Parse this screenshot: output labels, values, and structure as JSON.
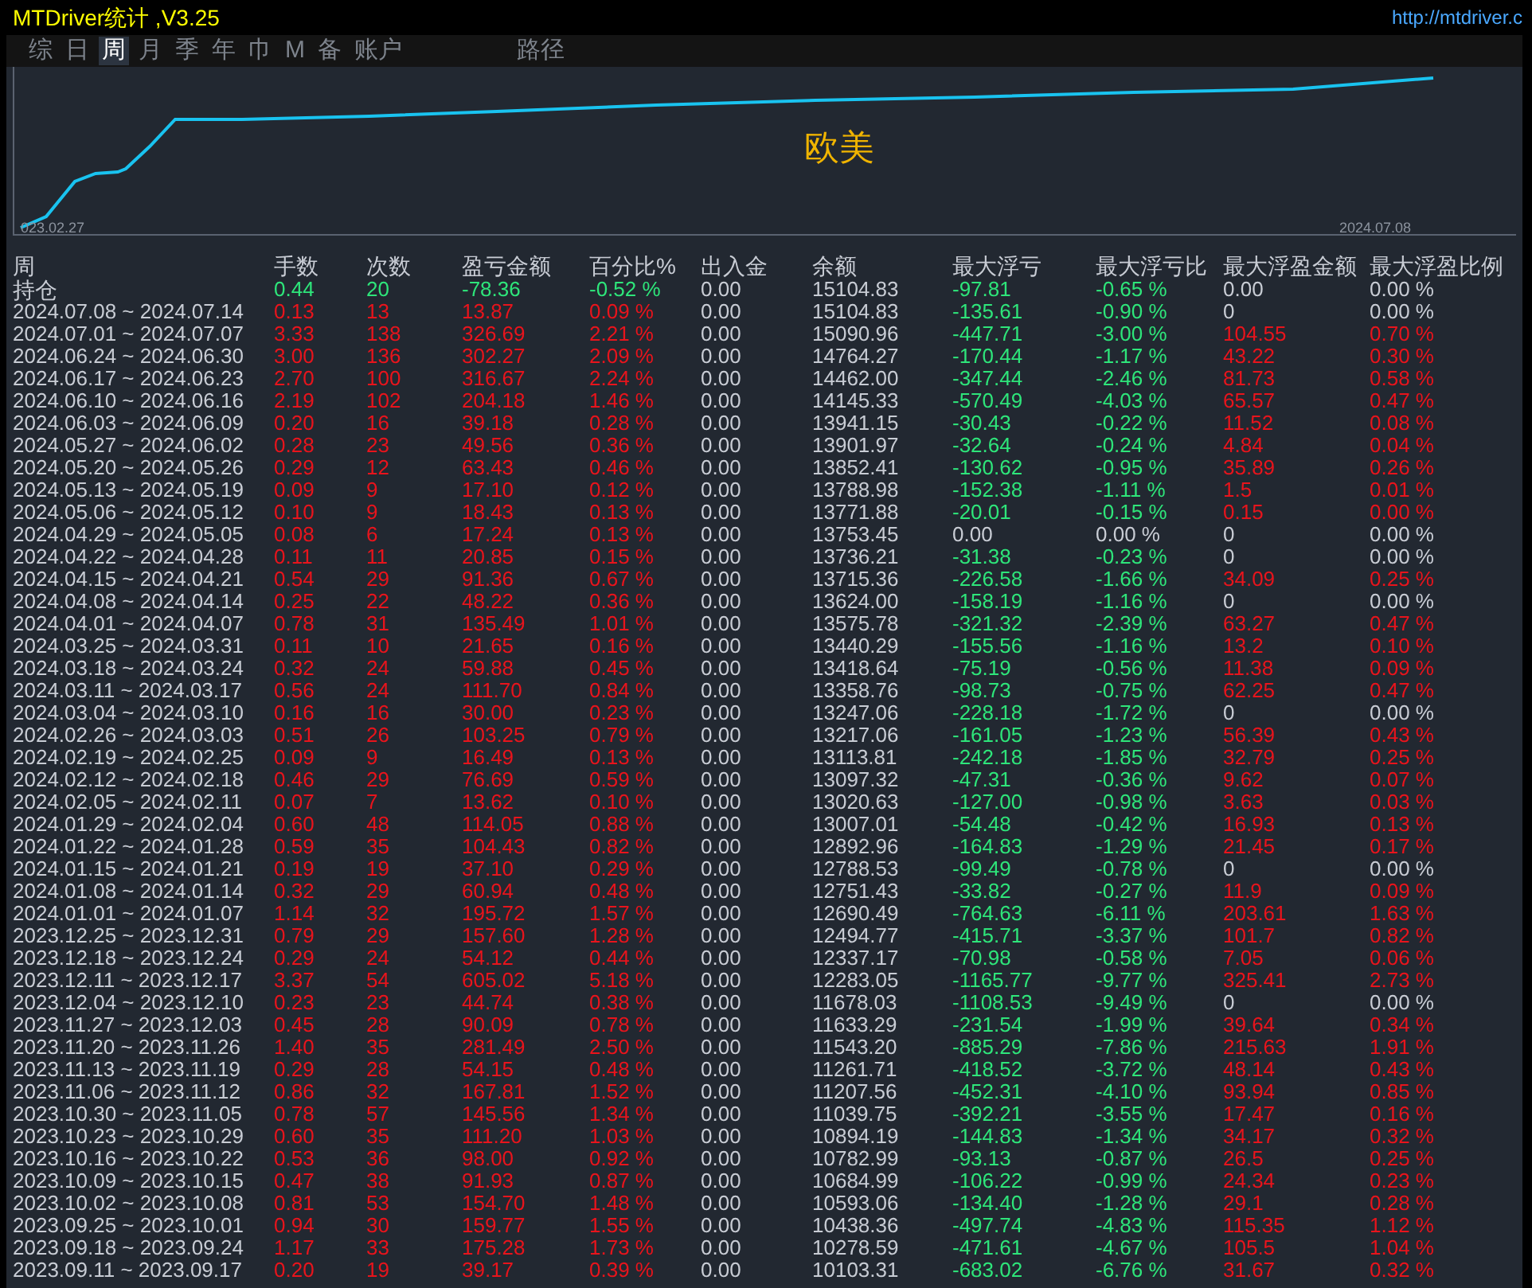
{
  "window": {
    "title": "MTDriver统计 ,V3.25",
    "link": "http://mtdriver.c"
  },
  "tabs": [
    {
      "label": "综",
      "selected": false
    },
    {
      "label": "日",
      "selected": false
    },
    {
      "label": "周",
      "selected": true
    },
    {
      "label": "月",
      "selected": false
    },
    {
      "label": "季",
      "selected": false
    },
    {
      "label": "年",
      "selected": false
    },
    {
      "label": "巾",
      "selected": false
    },
    {
      "label": "M",
      "selected": false
    },
    {
      "label": "备",
      "selected": false
    },
    {
      "label": "账户",
      "selected": false
    },
    {
      "label": "路径",
      "selected": false,
      "kind": "spaced"
    }
  ],
  "chart": {
    "symbol": "欧美",
    "start_label": "023.02.27",
    "end_label": "2024.07.08"
  },
  "table": {
    "columns": [
      "周",
      "手数",
      "次数",
      "盈亏金额",
      "百分比%",
      "出入金",
      "余额",
      "最大浮亏",
      "最大浮亏比",
      "最大浮盈金额",
      "最大浮盈比例"
    ],
    "rows": [
      {
        "cells": [
          "持仓",
          "0.44",
          "20",
          "-78.36",
          "-0.52 %",
          "0.00",
          "15104.83",
          "-97.81",
          "-0.65 %",
          "0.00",
          "0.00 %"
        ],
        "in_profit": false,
        "float_loss": true,
        "float_profit": false
      },
      {
        "cells": [
          "2024.07.08 ~ 2024.07.14",
          "0.13",
          "13",
          "13.87",
          "0.09 %",
          "0.00",
          "15104.83",
          "-135.61",
          "-0.90 %",
          "0",
          "0.00 %"
        ],
        "in_profit": true,
        "float_loss": true,
        "float_profit": false
      },
      {
        "cells": [
          "2024.07.01 ~ 2024.07.07",
          "3.33",
          "138",
          "326.69",
          "2.21 %",
          "0.00",
          "15090.96",
          "-447.71",
          "-3.00 %",
          "104.55",
          "0.70 %"
        ],
        "in_profit": true,
        "float_loss": true,
        "float_profit": true
      },
      {
        "cells": [
          "2024.06.24 ~ 2024.06.30",
          "3.00",
          "136",
          "302.27",
          "2.09 %",
          "0.00",
          "14764.27",
          "-170.44",
          "-1.17 %",
          "43.22",
          "0.30 %"
        ],
        "in_profit": true,
        "float_loss": true,
        "float_profit": true
      },
      {
        "cells": [
          "2024.06.17 ~ 2024.06.23",
          "2.70",
          "100",
          "316.67",
          "2.24 %",
          "0.00",
          "14462.00",
          "-347.44",
          "-2.46 %",
          "81.73",
          "0.58 %"
        ],
        "in_profit": true,
        "float_loss": true,
        "float_profit": true
      },
      {
        "cells": [
          "2024.06.10 ~ 2024.06.16",
          "2.19",
          "102",
          "204.18",
          "1.46 %",
          "0.00",
          "14145.33",
          "-570.49",
          "-4.03 %",
          "65.57",
          "0.47 %"
        ],
        "in_profit": true,
        "float_loss": true,
        "float_profit": true
      },
      {
        "cells": [
          "2024.06.03 ~ 2024.06.09",
          "0.20",
          "16",
          "39.18",
          "0.28 %",
          "0.00",
          "13941.15",
          "-30.43",
          "-0.22 %",
          "11.52",
          "0.08 %"
        ],
        "in_profit": true,
        "float_loss": true,
        "float_profit": true
      },
      {
        "cells": [
          "2024.05.27 ~ 2024.06.02",
          "0.28",
          "23",
          "49.56",
          "0.36 %",
          "0.00",
          "13901.97",
          "-32.64",
          "-0.24 %",
          "4.84",
          "0.04 %"
        ],
        "in_profit": true,
        "float_loss": true,
        "float_profit": true
      },
      {
        "cells": [
          "2024.05.20 ~ 2024.05.26",
          "0.29",
          "12",
          "63.43",
          "0.46 %",
          "0.00",
          "13852.41",
          "-130.62",
          "-0.95 %",
          "35.89",
          "0.26 %"
        ],
        "in_profit": true,
        "float_loss": true,
        "float_profit": true
      },
      {
        "cells": [
          "2024.05.13 ~ 2024.05.19",
          "0.09",
          "9",
          "17.10",
          "0.12 %",
          "0.00",
          "13788.98",
          "-152.38",
          "-1.11 %",
          "1.5",
          "0.01 %"
        ],
        "in_profit": true,
        "float_loss": true,
        "float_profit": true
      },
      {
        "cells": [
          "2024.05.06 ~ 2024.05.12",
          "0.10",
          "9",
          "18.43",
          "0.13 %",
          "0.00",
          "13771.88",
          "-20.01",
          "-0.15 %",
          "0.15",
          "0.00 %"
        ],
        "in_profit": true,
        "float_loss": true,
        "float_profit": true
      },
      {
        "cells": [
          "2024.04.29 ~ 2024.05.05",
          "0.08",
          "6",
          "17.24",
          "0.13 %",
          "0.00",
          "13753.45",
          "0.00",
          "0.00 %",
          "0",
          "0.00 %"
        ],
        "in_profit": true,
        "float_loss": false,
        "float_profit": false
      },
      {
        "cells": [
          "2024.04.22 ~ 2024.04.28",
          "0.11",
          "11",
          "20.85",
          "0.15 %",
          "0.00",
          "13736.21",
          "-31.38",
          "-0.23 %",
          "0",
          "0.00 %"
        ],
        "in_profit": true,
        "float_loss": true,
        "float_profit": false
      },
      {
        "cells": [
          "2024.04.15 ~ 2024.04.21",
          "0.54",
          "29",
          "91.36",
          "0.67 %",
          "0.00",
          "13715.36",
          "-226.58",
          "-1.66 %",
          "34.09",
          "0.25 %"
        ],
        "in_profit": true,
        "float_loss": true,
        "float_profit": true
      },
      {
        "cells": [
          "2024.04.08 ~ 2024.04.14",
          "0.25",
          "22",
          "48.22",
          "0.36 %",
          "0.00",
          "13624.00",
          "-158.19",
          "-1.16 %",
          "0",
          "0.00 %"
        ],
        "in_profit": true,
        "float_loss": true,
        "float_profit": false
      },
      {
        "cells": [
          "2024.04.01 ~ 2024.04.07",
          "0.78",
          "31",
          "135.49",
          "1.01 %",
          "0.00",
          "13575.78",
          "-321.32",
          "-2.39 %",
          "63.27",
          "0.47 %"
        ],
        "in_profit": true,
        "float_loss": true,
        "float_profit": true
      },
      {
        "cells": [
          "2024.03.25 ~ 2024.03.31",
          "0.11",
          "10",
          "21.65",
          "0.16 %",
          "0.00",
          "13440.29",
          "-155.56",
          "-1.16 %",
          "13.2",
          "0.10 %"
        ],
        "in_profit": true,
        "float_loss": true,
        "float_profit": true
      },
      {
        "cells": [
          "2024.03.18 ~ 2024.03.24",
          "0.32",
          "24",
          "59.88",
          "0.45 %",
          "0.00",
          "13418.64",
          "-75.19",
          "-0.56 %",
          "11.38",
          "0.09 %"
        ],
        "in_profit": true,
        "float_loss": true,
        "float_profit": true
      },
      {
        "cells": [
          "2024.03.11 ~ 2024.03.17",
          "0.56",
          "24",
          "111.70",
          "0.84 %",
          "0.00",
          "13358.76",
          "-98.73",
          "-0.75 %",
          "62.25",
          "0.47 %"
        ],
        "in_profit": true,
        "float_loss": true,
        "float_profit": true
      },
      {
        "cells": [
          "2024.03.04 ~ 2024.03.10",
          "0.16",
          "16",
          "30.00",
          "0.23 %",
          "0.00",
          "13247.06",
          "-228.18",
          "-1.72 %",
          "0",
          "0.00 %"
        ],
        "in_profit": true,
        "float_loss": true,
        "float_profit": false
      },
      {
        "cells": [
          "2024.02.26 ~ 2024.03.03",
          "0.51",
          "26",
          "103.25",
          "0.79 %",
          "0.00",
          "13217.06",
          "-161.05",
          "-1.23 %",
          "56.39",
          "0.43 %"
        ],
        "in_profit": true,
        "float_loss": true,
        "float_profit": true
      },
      {
        "cells": [
          "2024.02.19 ~ 2024.02.25",
          "0.09",
          "9",
          "16.49",
          "0.13 %",
          "0.00",
          "13113.81",
          "-242.18",
          "-1.85 %",
          "32.79",
          "0.25 %"
        ],
        "in_profit": true,
        "float_loss": true,
        "float_profit": true
      },
      {
        "cells": [
          "2024.02.12 ~ 2024.02.18",
          "0.46",
          "29",
          "76.69",
          "0.59 %",
          "0.00",
          "13097.32",
          "-47.31",
          "-0.36 %",
          "9.62",
          "0.07 %"
        ],
        "in_profit": true,
        "float_loss": true,
        "float_profit": true
      },
      {
        "cells": [
          "2024.02.05 ~ 2024.02.11",
          "0.07",
          "7",
          "13.62",
          "0.10 %",
          "0.00",
          "13020.63",
          "-127.00",
          "-0.98 %",
          "3.63",
          "0.03 %"
        ],
        "in_profit": true,
        "float_loss": true,
        "float_profit": true
      },
      {
        "cells": [
          "2024.01.29 ~ 2024.02.04",
          "0.60",
          "48",
          "114.05",
          "0.88 %",
          "0.00",
          "13007.01",
          "-54.48",
          "-0.42 %",
          "16.93",
          "0.13 %"
        ],
        "in_profit": true,
        "float_loss": true,
        "float_profit": true
      },
      {
        "cells": [
          "2024.01.22 ~ 2024.01.28",
          "0.59",
          "35",
          "104.43",
          "0.82 %",
          "0.00",
          "12892.96",
          "-164.83",
          "-1.29 %",
          "21.45",
          "0.17 %"
        ],
        "in_profit": true,
        "float_loss": true,
        "float_profit": true
      },
      {
        "cells": [
          "2024.01.15 ~ 2024.01.21",
          "0.19",
          "19",
          "37.10",
          "0.29 %",
          "0.00",
          "12788.53",
          "-99.49",
          "-0.78 %",
          "0",
          "0.00 %"
        ],
        "in_profit": true,
        "float_loss": true,
        "float_profit": false
      },
      {
        "cells": [
          "2024.01.08 ~ 2024.01.14",
          "0.32",
          "29",
          "60.94",
          "0.48 %",
          "0.00",
          "12751.43",
          "-33.82",
          "-0.27 %",
          "11.9",
          "0.09 %"
        ],
        "in_profit": true,
        "float_loss": true,
        "float_profit": true
      },
      {
        "cells": [
          "2024.01.01 ~ 2024.01.07",
          "1.14",
          "32",
          "195.72",
          "1.57 %",
          "0.00",
          "12690.49",
          "-764.63",
          "-6.11 %",
          "203.61",
          "1.63 %"
        ],
        "in_profit": true,
        "float_loss": true,
        "float_profit": true
      },
      {
        "cells": [
          "2023.12.25 ~ 2023.12.31",
          "0.79",
          "29",
          "157.60",
          "1.28 %",
          "0.00",
          "12494.77",
          "-415.71",
          "-3.37 %",
          "101.7",
          "0.82 %"
        ],
        "in_profit": true,
        "float_loss": true,
        "float_profit": true
      },
      {
        "cells": [
          "2023.12.18 ~ 2023.12.24",
          "0.29",
          "24",
          "54.12",
          "0.44 %",
          "0.00",
          "12337.17",
          "-70.98",
          "-0.58 %",
          "7.05",
          "0.06 %"
        ],
        "in_profit": true,
        "float_loss": true,
        "float_profit": true
      },
      {
        "cells": [
          "2023.12.11 ~ 2023.12.17",
          "3.37",
          "54",
          "605.02",
          "5.18 %",
          "0.00",
          "12283.05",
          "-1165.77",
          "-9.77 %",
          "325.41",
          "2.73 %"
        ],
        "in_profit": true,
        "float_loss": true,
        "float_profit": true
      },
      {
        "cells": [
          "2023.12.04 ~ 2023.12.10",
          "0.23",
          "23",
          "44.74",
          "0.38 %",
          "0.00",
          "11678.03",
          "-1108.53",
          "-9.49 %",
          "0",
          "0.00 %"
        ],
        "in_profit": true,
        "float_loss": true,
        "float_profit": false
      },
      {
        "cells": [
          "2023.11.27 ~ 2023.12.03",
          "0.45",
          "28",
          "90.09",
          "0.78 %",
          "0.00",
          "11633.29",
          "-231.54",
          "-1.99 %",
          "39.64",
          "0.34 %"
        ],
        "in_profit": true,
        "float_loss": true,
        "float_profit": true
      },
      {
        "cells": [
          "2023.11.20 ~ 2023.11.26",
          "1.40",
          "35",
          "281.49",
          "2.50 %",
          "0.00",
          "11543.20",
          "-885.29",
          "-7.86 %",
          "215.63",
          "1.91 %"
        ],
        "in_profit": true,
        "float_loss": true,
        "float_profit": true
      },
      {
        "cells": [
          "2023.11.13 ~ 2023.11.19",
          "0.29",
          "28",
          "54.15",
          "0.48 %",
          "0.00",
          "11261.71",
          "-418.52",
          "-3.72 %",
          "48.14",
          "0.43 %"
        ],
        "in_profit": true,
        "float_loss": true,
        "float_profit": true
      },
      {
        "cells": [
          "2023.11.06 ~ 2023.11.12",
          "0.86",
          "32",
          "167.81",
          "1.52 %",
          "0.00",
          "11207.56",
          "-452.31",
          "-4.10 %",
          "93.94",
          "0.85 %"
        ],
        "in_profit": true,
        "float_loss": true,
        "float_profit": true
      },
      {
        "cells": [
          "2023.10.30 ~ 2023.11.05",
          "0.78",
          "57",
          "145.56",
          "1.34 %",
          "0.00",
          "11039.75",
          "-392.21",
          "-3.55 %",
          "17.47",
          "0.16 %"
        ],
        "in_profit": true,
        "float_loss": true,
        "float_profit": true
      },
      {
        "cells": [
          "2023.10.23 ~ 2023.10.29",
          "0.60",
          "35",
          "111.20",
          "1.03 %",
          "0.00",
          "10894.19",
          "-144.83",
          "-1.34 %",
          "34.17",
          "0.32 %"
        ],
        "in_profit": true,
        "float_loss": true,
        "float_profit": true
      },
      {
        "cells": [
          "2023.10.16 ~ 2023.10.22",
          "0.53",
          "36",
          "98.00",
          "0.92 %",
          "0.00",
          "10782.99",
          "-93.13",
          "-0.87 %",
          "26.5",
          "0.25 %"
        ],
        "in_profit": true,
        "float_loss": true,
        "float_profit": true
      },
      {
        "cells": [
          "2023.10.09 ~ 2023.10.15",
          "0.47",
          "38",
          "91.93",
          "0.87 %",
          "0.00",
          "10684.99",
          "-106.22",
          "-0.99 %",
          "24.34",
          "0.23 %"
        ],
        "in_profit": true,
        "float_loss": true,
        "float_profit": true
      },
      {
        "cells": [
          "2023.10.02 ~ 2023.10.08",
          "0.81",
          "53",
          "154.70",
          "1.48 %",
          "0.00",
          "10593.06",
          "-134.40",
          "-1.28 %",
          "29.1",
          "0.28 %"
        ],
        "in_profit": true,
        "float_loss": true,
        "float_profit": true
      },
      {
        "cells": [
          "2023.09.25 ~ 2023.10.01",
          "0.94",
          "30",
          "159.77",
          "1.55 %",
          "0.00",
          "10438.36",
          "-497.74",
          "-4.83 %",
          "115.35",
          "1.12 %"
        ],
        "in_profit": true,
        "float_loss": true,
        "float_profit": true
      },
      {
        "cells": [
          "2023.09.18 ~ 2023.09.24",
          "1.17",
          "33",
          "175.28",
          "1.73 %",
          "0.00",
          "10278.59",
          "-471.61",
          "-4.67 %",
          "105.5",
          "1.04 %"
        ],
        "in_profit": true,
        "float_loss": true,
        "float_profit": true
      },
      {
        "cells": [
          "2023.09.11 ~ 2023.09.17",
          "0.20",
          "19",
          "39.17",
          "0.39 %",
          "0.00",
          "10103.31",
          "-683.02",
          "-6.76 %",
          "31.67",
          "0.32 %"
        ],
        "in_profit": true,
        "float_loss": true,
        "float_profit": true
      }
    ]
  }
}
